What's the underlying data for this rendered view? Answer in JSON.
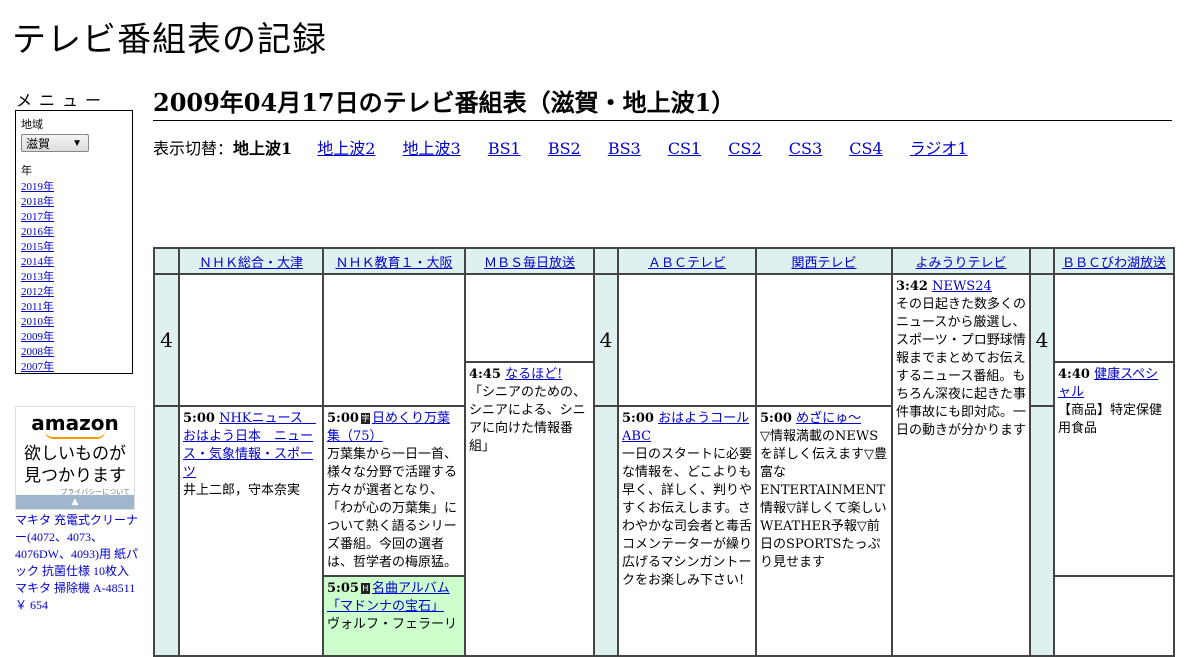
{
  "site_title": "テレビ番組表の記録",
  "menu": {
    "label": "メニュー",
    "region_label": "地域",
    "region_value": "滋賀",
    "year_label": "年",
    "years": [
      "2019年",
      "2018年",
      "2017年",
      "2016年",
      "2015年",
      "2014年",
      "2013年",
      "2012年",
      "2011年",
      "2010年",
      "2009年",
      "2008年",
      "2007年"
    ]
  },
  "ad": {
    "logo": "amazon",
    "copy_line1": "欲しいものが",
    "copy_line2": "見つかります",
    "privacy": "プライバシーについて",
    "product": "マキタ 充電式クリーナー(4072、4073、4076DW、4093)用 紙パック 抗菌仕様 10枚入 マキタ 掃除機 A-48511",
    "price": "￥ 654"
  },
  "page_title": "2009年04月17日のテレビ番組表（滋賀・地上波1）",
  "switcher": {
    "label": "表示切替：",
    "current": "地上波1",
    "links": [
      "地上波2",
      "地上波3",
      "BS1",
      "BS2",
      "BS3",
      "CS1",
      "CS2",
      "CS3",
      "CS4",
      "ラジオ1"
    ]
  },
  "channels": [
    "ＮＨＫ総合・大津",
    "ＮＨＫ教育１・大阪",
    "ＭＢＳ毎日放送",
    "ＡＢＣテレビ",
    "関西テレビ",
    "よみうりテレビ",
    "ＢＢＣびわ湖放送"
  ],
  "hour": "4",
  "programs": {
    "mbs_445": {
      "time": "4:45",
      "title": "なるほど!",
      "desc": "「シニアのための、シニアによる、シニアに向けた情報番組」"
    },
    "ytv_342": {
      "time": "3:42",
      "title": "NEWS24",
      "desc": "その日起きた数多くのニュースから厳選し、スポーツ・プロ野球情報までまとめてお伝えするニュース番組。もちろん深夜に起きた事件事故にも即対応。一日の動きが分かります"
    },
    "bbc_440": {
      "time": "4:40",
      "title": "健康スペシャル",
      "desc": "【商品】特定保健用食品"
    },
    "nhk_500": {
      "time": "5:00",
      "title": "NHKニュース　おはよう日本　ニュース・気象情報・スポーツ",
      "desc": "井上二郎，守本奈実"
    },
    "etv_500": {
      "time": "5:00",
      "badge": "字",
      "title": "日めくり万葉集（75）",
      "desc": "万葉集から一日一首、様々な分野で活躍する方々が選者となり、「わが心の万葉集」について熱く語るシリーズ番組。今回の選者は、哲学者の梅原猛。"
    },
    "etv_505": {
      "time": "5:05",
      "badge": "H",
      "title": "名曲アルバム「マドンナの宝石」",
      "desc": "ヴォルフ・フェラーリ"
    },
    "abc_500": {
      "time": "5:00",
      "title": "おはようコールABC",
      "desc": "一日のスタートに必要な情報を、どこよりも早く、詳しく、判りやすくお伝えします。さわやかな司会者と毒舌コメンテーターが繰り広げるマシンガントークをお楽しみ下さい!"
    },
    "ktv_500": {
      "time": "5:00",
      "title": "めざにゅ～",
      "desc": "▽情報満載のNEWSを詳しく伝えます▽豊富なENTERTAINMENT情報▽詳しくて楽しいWEATHER予報▽前日のSPORTSたっぷり見せます"
    }
  }
}
